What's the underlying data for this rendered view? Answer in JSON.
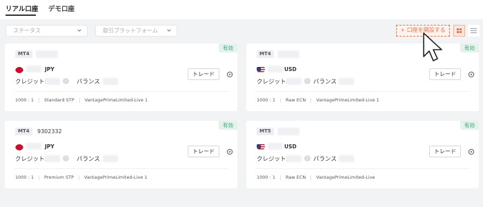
{
  "tabs": [
    {
      "label": "リアル口座",
      "active": true
    },
    {
      "label": "デモ口座",
      "active": false
    }
  ],
  "filters": {
    "status_placeholder": "ステータス",
    "platform_placeholder": "取引プラットフォーム"
  },
  "toolbar": {
    "open_account_label": "+ 口座を開設する"
  },
  "labels": {
    "active": "有効",
    "trade": "トレード",
    "credit": "クレジット:",
    "balance": "バランス"
  },
  "accounts": [
    {
      "platform": "MT4",
      "account_number": "",
      "currency": "JPY",
      "flag": "japan",
      "leverage": "1000 : 1",
      "account_type": "Standard STP",
      "server": "VantagePrimeLimited-Live 1"
    },
    {
      "platform": "MT4",
      "account_number": "",
      "currency": "USD",
      "flag": "usa",
      "leverage": "1000 : 1",
      "account_type": "Raw ECN",
      "server": "VantagePrimeLimited-Live 1"
    },
    {
      "platform": "MT4",
      "account_number": "9302332",
      "currency": "JPY",
      "flag": "japan",
      "leverage": "1000 : 1",
      "account_type": "Premium STP",
      "server": "VantagePrimeLimited-Live 1"
    },
    {
      "platform": "MT5",
      "account_number": "",
      "currency": "USD",
      "flag": "usa",
      "leverage": "1000 : 1",
      "account_type": "Raw ECN",
      "server": "VantagePrimeLimited-Live"
    }
  ],
  "colors": {
    "accent": "#e8744a",
    "active_badge_bg": "#e3f3ec",
    "active_badge_text": "#3aa57a",
    "background": "#f2f3f5"
  },
  "icons": [
    "chevron-down-icon",
    "grid-view-icon",
    "list-view-icon",
    "gear-icon",
    "info-icon",
    "japan-flag-icon",
    "usa-flag-icon",
    "mouse-cursor-icon"
  ]
}
